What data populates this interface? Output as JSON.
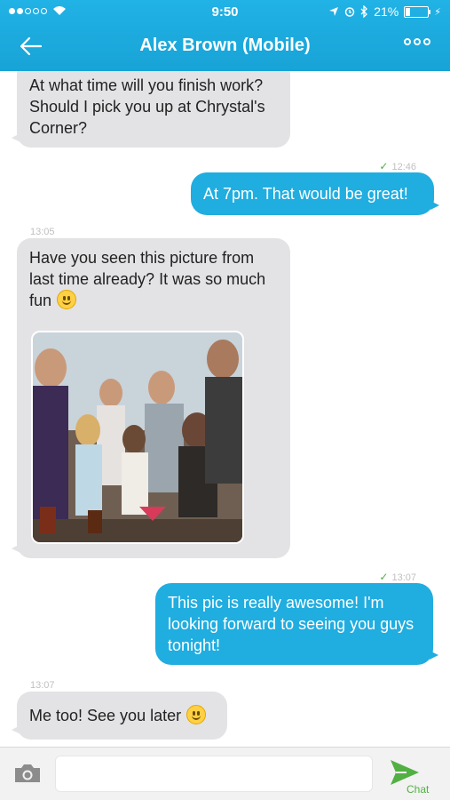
{
  "status_bar": {
    "time": "9:50",
    "battery": "21%",
    "battery_level": 0.21
  },
  "header": {
    "title": "Alex Brown (Mobile)"
  },
  "messages": [
    {
      "direction": "in",
      "text": "At what time will you finish work? Should I pick you up at Chrystal's Corner?"
    },
    {
      "direction": "out",
      "time": "12:46",
      "read": true,
      "text": "At 7pm. That would be great!"
    },
    {
      "direction": "in",
      "time": "13:05",
      "text": "Have you seen this picture from last time already? It was so much fun",
      "emoji": "grinning-face",
      "has_image": true
    },
    {
      "direction": "out",
      "time": "13:07",
      "read": true,
      "text": "This pic is really awesome! I'm looking forward to seeing you guys tonight!"
    },
    {
      "direction": "in",
      "time": "13:07",
      "text": "Me too! See you later",
      "emoji": "smiling-face"
    }
  ],
  "composer": {
    "value": "",
    "send_label": "Chat"
  },
  "colors": {
    "accent": "#1ea8de",
    "incoming_bubble": "#e3e3e6",
    "outgoing_bubble": "#20ade0",
    "send": "#52b043"
  }
}
